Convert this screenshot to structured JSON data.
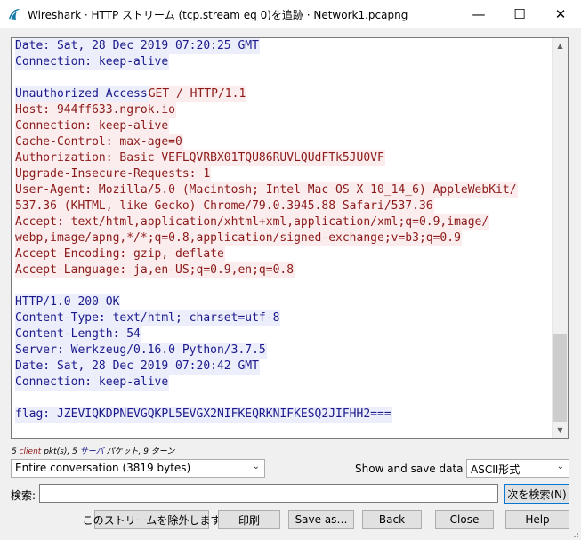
{
  "window": {
    "title": "Wireshark · HTTP ストリーム (tcp.stream eq 0)を追跡 · Network1.pcapng",
    "minimize_glyph": "—",
    "maximize_glyph": "☐",
    "close_glyph": "✕"
  },
  "stream": {
    "lines": [
      {
        "dir": "server",
        "text": "Date: Sat, 28 Dec 2019 07:20:25 GMT"
      },
      {
        "dir": "server",
        "text": "Connection: keep-alive"
      },
      {
        "dir": "blank",
        "text": ""
      },
      {
        "dir": "server",
        "text": "Unauthorized Access",
        "rest_client": "GET / HTTP/1.1"
      },
      {
        "dir": "client",
        "text": "Host: 944ff633.ngrok.io"
      },
      {
        "dir": "client",
        "text": "Connection: keep-alive"
      },
      {
        "dir": "client",
        "text": "Cache-Control: max-age=0"
      },
      {
        "dir": "client",
        "text": "Authorization: Basic VEFLQVRBX01TQU86RUVLQUdFTk5JU0VF"
      },
      {
        "dir": "client",
        "text": "Upgrade-Insecure-Requests: 1"
      },
      {
        "dir": "client",
        "text": "User-Agent: Mozilla/5.0 (Macintosh; Intel Mac OS X 10_14_6) AppleWebKit/"
      },
      {
        "dir": "client",
        "text": "537.36 (KHTML, like Gecko) Chrome/79.0.3945.88 Safari/537.36"
      },
      {
        "dir": "client",
        "text": "Accept: text/html,application/xhtml+xml,application/xml;q=0.9,image/"
      },
      {
        "dir": "client",
        "text": "webp,image/apng,*/*;q=0.8,application/signed-exchange;v=b3;q=0.9"
      },
      {
        "dir": "client",
        "text": "Accept-Encoding: gzip, deflate"
      },
      {
        "dir": "client",
        "text": "Accept-Language: ja,en-US;q=0.9,en;q=0.8"
      },
      {
        "dir": "blank",
        "text": ""
      },
      {
        "dir": "server",
        "text": "HTTP/1.0 200 OK"
      },
      {
        "dir": "server",
        "text": "Content-Type: text/html; charset=utf-8"
      },
      {
        "dir": "server",
        "text": "Content-Length: 54"
      },
      {
        "dir": "server",
        "text": "Server: Werkzeug/0.16.0 Python/3.7.5"
      },
      {
        "dir": "server",
        "text": "Date: Sat, 28 Dec 2019 07:20:42 GMT"
      },
      {
        "dir": "server",
        "text": "Connection: keep-alive"
      },
      {
        "dir": "blank",
        "text": ""
      },
      {
        "dir": "server",
        "text": "flag: JZEVIQKDPNEVGQKPL5EVGX2NIFKEQRKNIFKESQ2JIFHH2==="
      }
    ]
  },
  "summary": {
    "count_client": "5",
    "client_word": "client",
    "pkts_text": " pkt(s), 5 ",
    "server_word": "サーバ",
    "tail_text": " パケット, 9 ターン"
  },
  "controls": {
    "conversation_value": "Entire conversation (3819 bytes)",
    "format_label": "Show and save data as",
    "format_value": "ASCII形式",
    "find_label": "検索:",
    "find_value": "",
    "find_button": "次を検索(N)"
  },
  "buttons": {
    "filter_out": "このストリームを除外します",
    "print": "印刷",
    "save_as": "Save as…",
    "back": "Back",
    "close": "Close",
    "help": "Help"
  },
  "colors": {
    "server_fg": "#1a1a8c",
    "server_bg": "#edeefb",
    "client_fg": "#8c1a1a",
    "client_bg": "#fbeded"
  }
}
